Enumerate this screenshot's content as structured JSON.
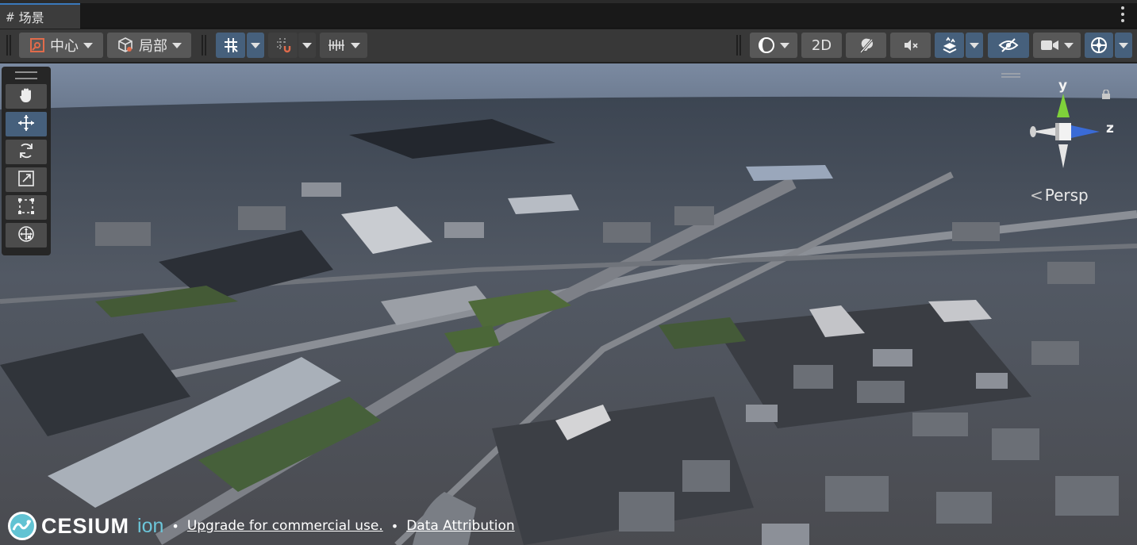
{
  "tab": {
    "icon": "#",
    "label": "场景"
  },
  "toolbar": {
    "pivot_label": "中心",
    "space_label": "局部",
    "mode_2d_label": "2D"
  },
  "scene": {
    "camera_mode": "Persp",
    "axes": {
      "y": "y",
      "z": "z"
    },
    "axis_colors": {
      "y": "#7fd13a",
      "z": "#3a6bd6",
      "x": "#e8e8e8"
    }
  },
  "credits": {
    "logo_word": "CESIUM",
    "logo_suffix": "ion",
    "separator": "•",
    "upgrade_link": "Upgrade for commercial use.",
    "attribution_link": "Data Attribution"
  },
  "colors": {
    "accent": "#46607c",
    "tab_highlight": "#3a79bb",
    "toolbar_bg": "#383838",
    "button_bg": "#585858"
  }
}
